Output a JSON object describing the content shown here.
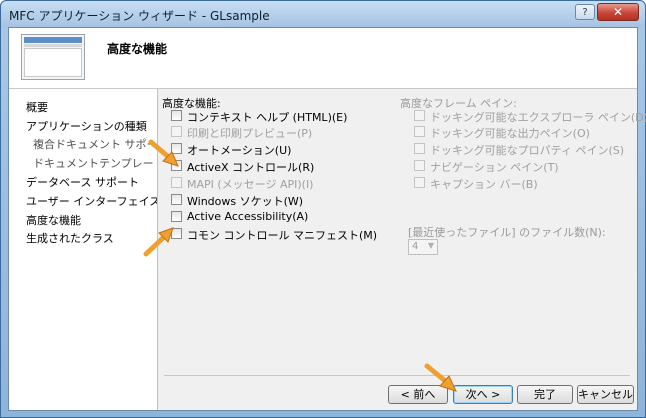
{
  "window": {
    "title": "MFC アプリケーション ウィザード - GLsample",
    "help_label": "?",
    "close_label": "✕"
  },
  "header": {
    "title": "高度な機能"
  },
  "nav": {
    "items": [
      {
        "label": "概要"
      },
      {
        "label": "アプリケーションの種類"
      },
      {
        "label": "複合ドキュメント サポート"
      },
      {
        "label": "ドキュメントテンプレート文字列"
      },
      {
        "label": "データベース サポート"
      },
      {
        "label": "ユーザー インターフェイス機能"
      },
      {
        "label": "高度な機能"
      },
      {
        "label": "生成されたクラス"
      }
    ]
  },
  "advanced": {
    "label": "高度な機能:",
    "options": [
      {
        "label": "コンテキスト ヘルプ (HTML)(E)",
        "checked": false,
        "enabled": true
      },
      {
        "label": "印刷と印刷プレビュー(P)",
        "checked": false,
        "enabled": false
      },
      {
        "label": "オートメーション(U)",
        "checked": false,
        "enabled": true
      },
      {
        "label": "ActiveX コントロール(R)",
        "checked": false,
        "enabled": true
      },
      {
        "label": "MAPI (メッセージ API)(I)",
        "checked": false,
        "enabled": false
      },
      {
        "label": "Windows ソケット(W)",
        "checked": false,
        "enabled": true
      },
      {
        "label": "Active Accessibility(A)",
        "checked": false,
        "enabled": true
      },
      {
        "label": "コモン コントロール マニフェスト(M)",
        "checked": false,
        "enabled": true
      }
    ]
  },
  "frame_panes": {
    "label": "高度なフレーム ペイン:",
    "options": [
      {
        "label": "ドッキング可能なエクスプローラ ペイン(D)"
      },
      {
        "label": "ドッキング可能な出力ペイン(O)"
      },
      {
        "label": "ドッキング可能なプロパティ ペイン(S)"
      },
      {
        "label": "ナビゲーション ペイン(T)"
      },
      {
        "label": "キャプション バー(B)"
      }
    ]
  },
  "recent_files": {
    "label": "[最近使ったファイル] のファイル数(N):",
    "value": "4"
  },
  "buttons": {
    "prev": "< 前へ",
    "next": "次へ >",
    "finish": "完了",
    "cancel": "キャンセル"
  },
  "colors": {
    "arrow": "#f0a030",
    "title_bar": "#a5c3e3"
  },
  "icons": {
    "arrow": "pointer-arrow-icon"
  }
}
